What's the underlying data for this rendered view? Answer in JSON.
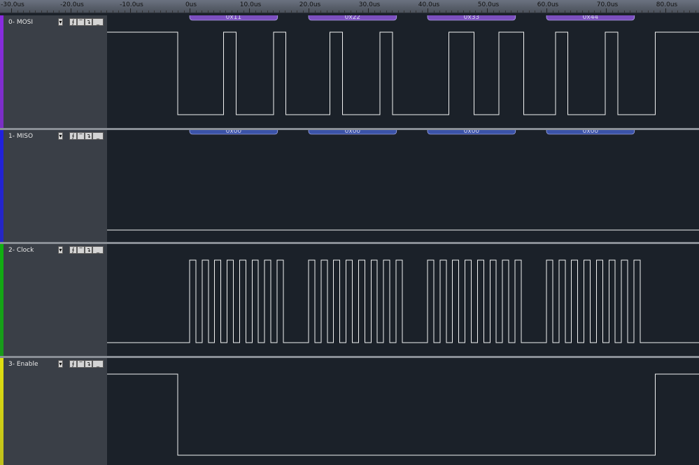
{
  "ruler": {
    "ticks": [
      "-30.0us",
      "-20.0us",
      "-10.0us",
      "0us",
      "10.0us",
      "20.0us",
      "30.0us",
      "40.0us",
      "50.0us",
      "60.0us",
      "70.0us",
      "80.0us"
    ]
  },
  "channels": [
    {
      "name": "0- MOSI",
      "color": "#8a2be2",
      "decoder_color": "#7c4fbf",
      "decoded": [
        "0x11",
        "0x22",
        "0x33",
        "0x44"
      ],
      "signal": "mosi"
    },
    {
      "name": "1- MISO",
      "color": "#2020e0",
      "decoder_color": "#3b53a8",
      "decoded": [
        "0x00",
        "0x00",
        "0x00",
        "0x00"
      ],
      "signal": "miso"
    },
    {
      "name": "2- Clock",
      "color": "#10b010",
      "decoder_color": null,
      "decoded": [],
      "signal": "clock"
    },
    {
      "name": "3- Enable",
      "color": "#e0e010",
      "decoder_color": null,
      "decoded": [],
      "signal": "enable"
    }
  ],
  "controls": {
    "menu_icon": "dropdown-arrow-icon",
    "trigger_rising": "rising-edge-trigger-icon",
    "trigger_high": "high-level-trigger-icon",
    "trigger_falling": "falling-edge-trigger-icon",
    "trigger_low": "low-level-trigger-icon"
  }
}
